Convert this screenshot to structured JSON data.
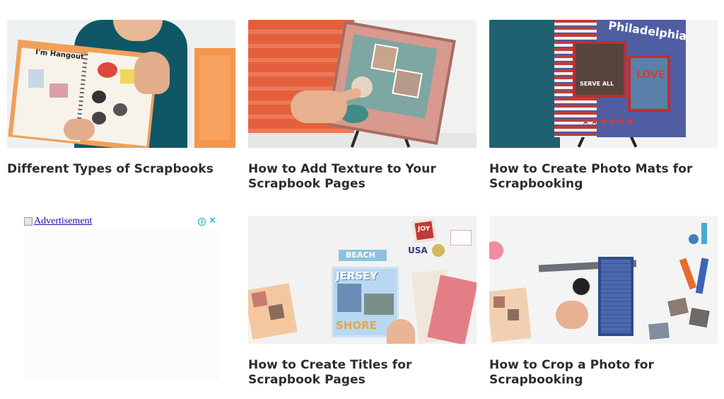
{
  "cards": [
    {
      "title": "Different Types of Scrapbooks"
    },
    {
      "title": "How to Add Texture to Your Scrapbook Pages"
    },
    {
      "title": "How to Create Photo Mats for Scrapbooking"
    },
    {
      "title": "How to Create Titles for Scrapbook Pages"
    },
    {
      "title": "How to Crop a Photo for Scrapbooking"
    }
  ],
  "ad": {
    "label": "Advertisement",
    "info_glyph": "i",
    "close_glyph": "✕"
  },
  "thumb_text": {
    "hangout": "I'm Hangout",
    "philadelphia": "Philadelphia",
    "serve_all": "SERVE ALL",
    "love": "LOVE",
    "stars": "★★★★★★",
    "jersey": "JERSEY",
    "shore": "SHORE",
    "joy": "JOY",
    "usa": "USA",
    "beach": "BEACH"
  },
  "colors": {
    "title_text": "#2d2d2d",
    "ad_link": "#1a0dab",
    "ad_choices": "#00aecd"
  }
}
